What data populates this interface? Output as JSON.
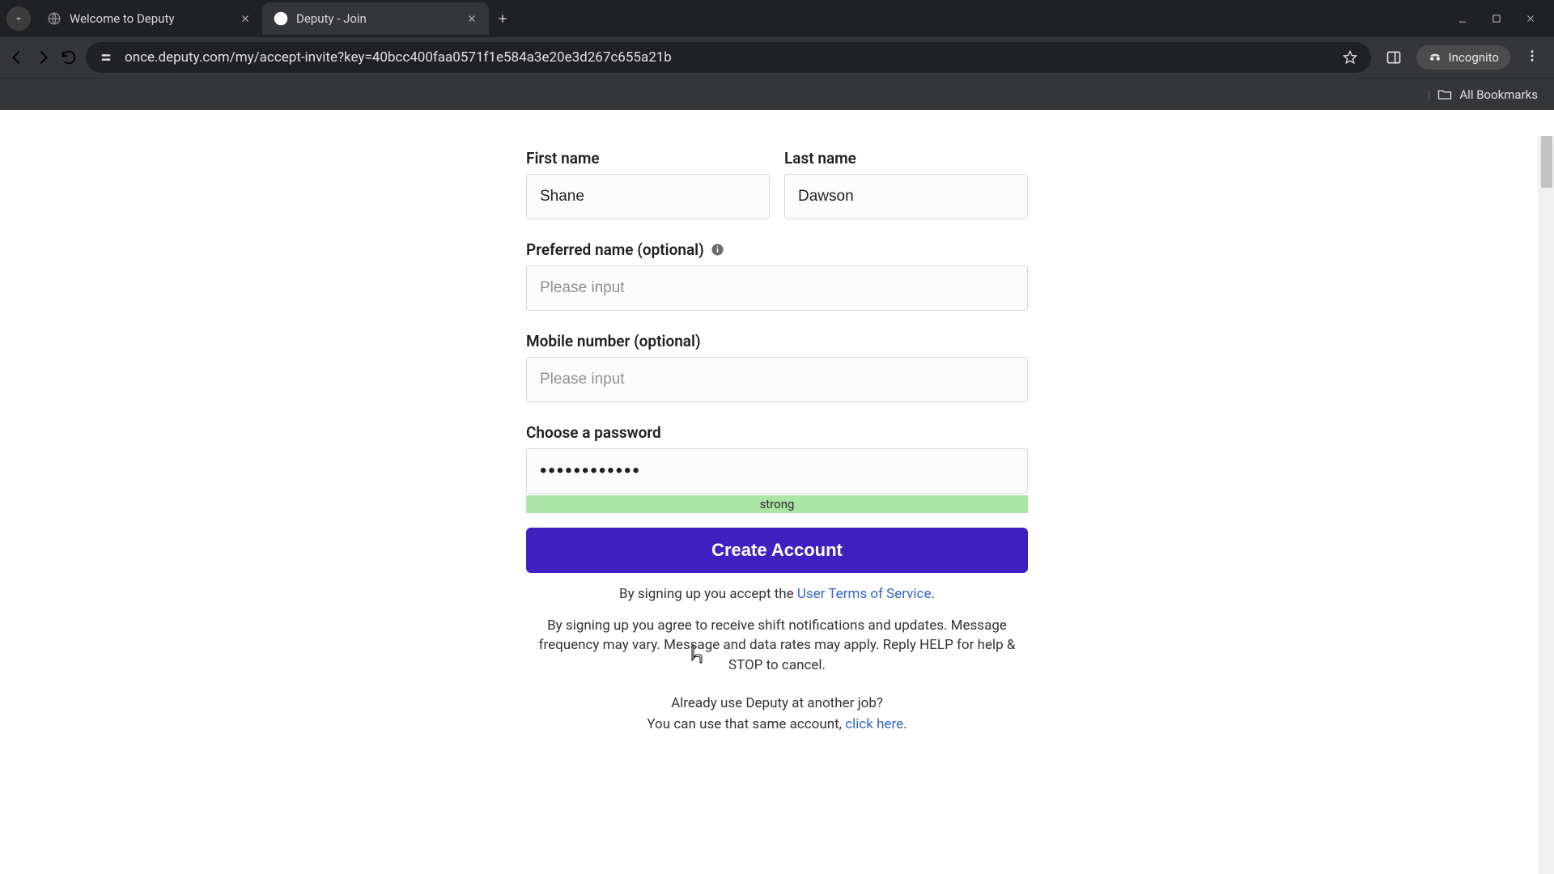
{
  "browser": {
    "tabs": [
      {
        "title": "Welcome to Deputy",
        "active": false
      },
      {
        "title": "Deputy - Join",
        "active": true
      }
    ],
    "url": "once.deputy.com/my/accept-invite?key=40bcc400faa0571f1e584a3e20e3d267c655a21b",
    "incognito_label": "Incognito",
    "all_bookmarks": "All Bookmarks"
  },
  "form": {
    "first_name": {
      "label": "First name",
      "value": "Shane"
    },
    "last_name": {
      "label": "Last name",
      "value": "Dawson"
    },
    "preferred_name": {
      "label": "Preferred name (optional)",
      "placeholder": "Please input",
      "value": ""
    },
    "mobile": {
      "label": "Mobile number (optional)",
      "placeholder": "Please input",
      "value": ""
    },
    "password": {
      "label": "Choose a password",
      "value": "••••••••••••",
      "strength": "strong"
    },
    "submit": "Create Account",
    "tos_pre": "By signing up you accept the ",
    "tos_link": "User Terms of Service",
    "tos_post": ".",
    "sms": "By signing up you agree to receive shift notifications and updates. Message frequency may vary. Message and data rates may apply. Reply HELP for help & STOP to cancel.",
    "existing_q": "Already use Deputy at another job?",
    "existing_pre": "You can use that same account, ",
    "existing_link": "click here",
    "existing_post": "."
  }
}
